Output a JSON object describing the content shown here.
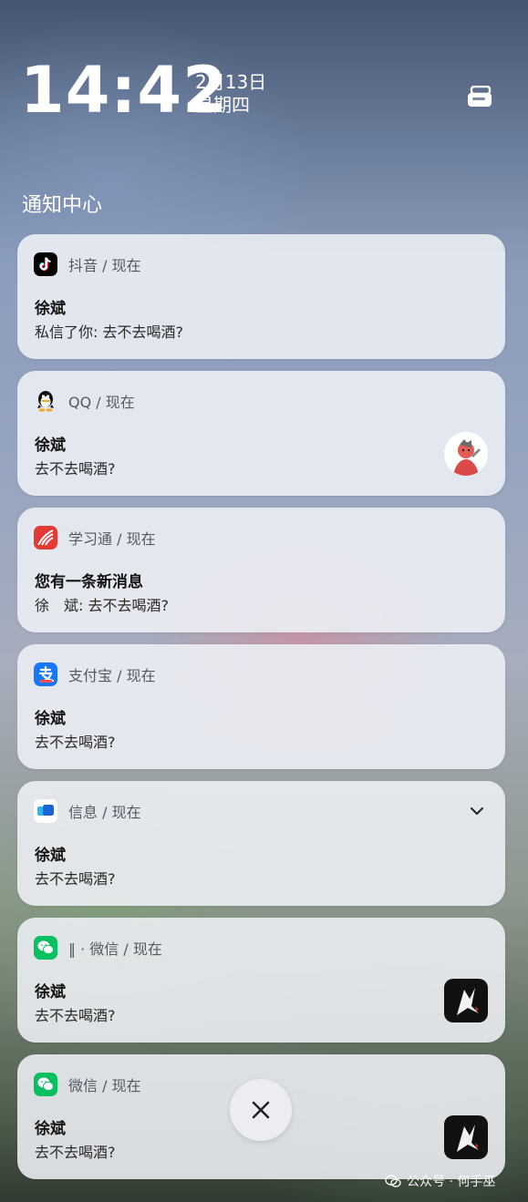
{
  "header": {
    "time": "14:42",
    "date": "2月13日",
    "weekday": "星期四",
    "section_title": "通知中心"
  },
  "notifications": [
    {
      "app": "抖音 / 现在",
      "title": "徐斌",
      "body": "私信了你: 去不去喝酒?",
      "icon": "douyin-icon"
    },
    {
      "app": "QQ / 现在",
      "title": "徐斌",
      "body": "去不去喝酒?",
      "icon": "qq-icon"
    },
    {
      "app": "学习通 / 现在",
      "title": "您有一条新消息",
      "body": "徐　斌: 去不去喝酒?",
      "icon": "xuexitong-icon"
    },
    {
      "app": "支付宝 / 现在",
      "title": "徐斌",
      "body": "去不去喝酒?",
      "icon": "alipay-icon"
    },
    {
      "app": "信息 / 现在",
      "title": "徐斌",
      "body": "去不去喝酒?",
      "icon": "messages-icon"
    },
    {
      "app": "‖ · 微信 / 现在",
      "title": "徐斌",
      "body": "去不去喝酒?",
      "icon": "wechat-icon"
    },
    {
      "app": "微信 / 现在",
      "title": "徐斌",
      "body": "去不去喝酒?",
      "icon": "wechat-icon"
    }
  ],
  "watermark": "公众号 · 何手巫",
  "colors": {
    "douyin": "#000000",
    "qq_bg": "#ffffff",
    "xuexitong": "#e53935",
    "alipay": "#1677ff",
    "messages": "#1e88e5",
    "wechat": "#07c160"
  }
}
